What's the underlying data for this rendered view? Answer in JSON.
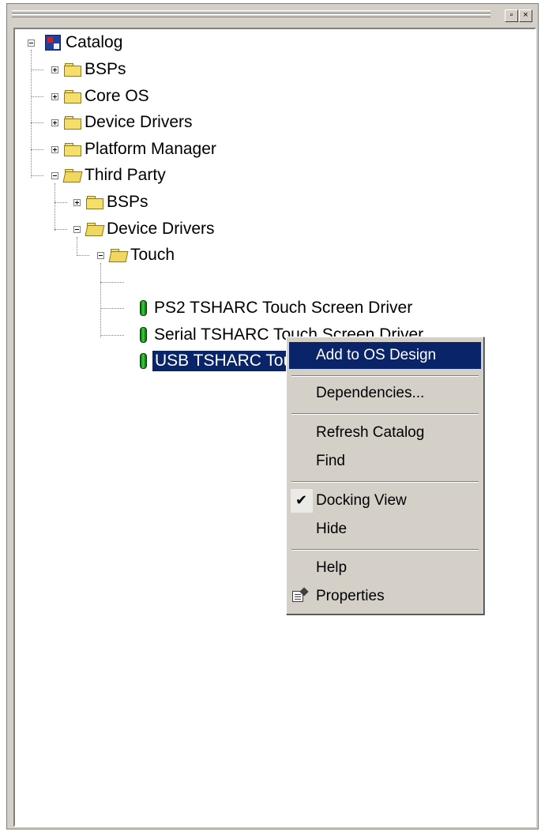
{
  "window": {
    "minimize_glyph": "▫",
    "close_glyph": "×"
  },
  "tree": {
    "root": {
      "label": "Catalog",
      "icon": "catalog-icon"
    },
    "items": [
      {
        "label": "BSPs",
        "icon": "folder-icon",
        "expanded": false
      },
      {
        "label": "Core OS",
        "icon": "folder-icon",
        "expanded": false
      },
      {
        "label": "Device Drivers",
        "icon": "folder-icon",
        "expanded": false
      },
      {
        "label": "Platform Manager",
        "icon": "folder-icon",
        "expanded": false
      },
      {
        "label": "Third Party",
        "icon": "folder-open-icon",
        "expanded": true
      }
    ],
    "third_party": [
      {
        "label": "BSPs",
        "icon": "folder-icon",
        "expanded": false
      },
      {
        "label": "Device Drivers",
        "icon": "folder-open-icon",
        "expanded": true
      }
    ],
    "touch": {
      "label": "Touch",
      "icon": "folder-open-icon",
      "expanded": true
    },
    "drivers": [
      {
        "label": "PS2 TSHARC Touch Screen Driver",
        "icon": "component-icon"
      },
      {
        "label": "Serial TSHARC Touch Screen Driver",
        "icon": "component-icon"
      },
      {
        "label": "USB TSHARC Touch Screen Driver",
        "icon": "component-icon",
        "selected": true
      }
    ]
  },
  "context_menu": {
    "add_to_os_design": "Add to OS Design",
    "dependencies": "Dependencies...",
    "refresh_catalog": "Refresh Catalog",
    "find": "Find",
    "docking_view": "Docking View",
    "docking_view_checked": true,
    "check_glyph": "✔",
    "hide": "Hide",
    "help": "Help",
    "properties": "Properties"
  },
  "colors": {
    "selection": "#0a246a",
    "face": "#d4d0c8"
  }
}
